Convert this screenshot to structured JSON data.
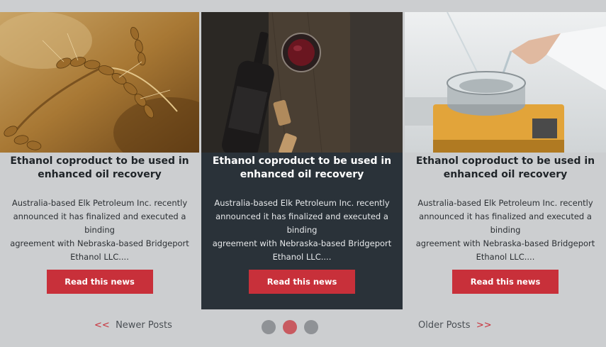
{
  "posts": [
    {
      "image": "wheat-ears-photo",
      "title_line1": "Ethanol coproduct to be used in",
      "title_line2": "enhanced oil recovery",
      "desc_lines": [
        "Australia-based Elk Petroleum Inc. recently",
        "announced it has finalized and executed a binding",
        "agreement with Nebraska-based Bridgeport",
        "Ethanol LLC...."
      ],
      "button": "Read this news"
    },
    {
      "image": "wine-bottle-glass-corks-photo",
      "title_line1": "Ethanol coproduct to be used in",
      "title_line2": "enhanced oil recovery",
      "desc_lines": [
        "Australia-based Elk Petroleum Inc. recently",
        "announced it has finalized and executed a binding",
        "agreement with Nebraska-based Bridgeport",
        "Ethanol LLC...."
      ],
      "button": "Read this news"
    },
    {
      "image": "lab-glassware-heater-photo",
      "title_line1": "Ethanol coproduct to be used in",
      "title_line2": "enhanced oil recovery",
      "desc_lines": [
        "Australia-based Elk Petroleum Inc. recently",
        "announced it has finalized and executed a binding",
        "agreement with Nebraska-based Bridgeport",
        "Ethanol LLC...."
      ],
      "button": "Read this news"
    }
  ],
  "pager": {
    "newer_arrow": "<<",
    "newer_label": "Newer Posts",
    "older_label": "Older Posts",
    "older_arrow": ">>",
    "active_dot": 2,
    "dot_count": 3
  },
  "colors": {
    "accent": "#c8303a",
    "active_card": "#2a3239",
    "background": "#ccced0"
  }
}
